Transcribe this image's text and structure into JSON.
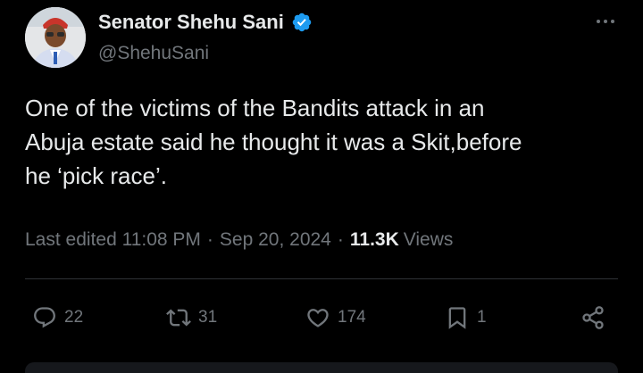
{
  "author": {
    "display_name": "Senator Shehu Sani",
    "handle": "@ShehuSani",
    "verified_color": "#1d9bf0"
  },
  "tweet": {
    "text": "One of the victims of the Bandits attack in an\nAbuja estate said he thought it was a Skit,before\nhe ‘pick race’."
  },
  "meta": {
    "edited_label": "Last edited",
    "time": "11:08 PM",
    "date": "Sep 20, 2024",
    "views_count": "11.3K",
    "views_label": "Views",
    "separator": "·"
  },
  "actions": {
    "replies": "22",
    "reposts": "31",
    "likes": "174",
    "bookmarks": "1"
  },
  "icons": [
    "verified-badge-icon",
    "more-icon",
    "reply-icon",
    "repost-icon",
    "like-icon",
    "bookmark-icon",
    "share-icon"
  ],
  "colors": {
    "background": "#000000",
    "text_primary": "#e7e9ea",
    "text_secondary": "#71767b",
    "divider": "#2f3336",
    "accent": "#1d9bf0"
  }
}
